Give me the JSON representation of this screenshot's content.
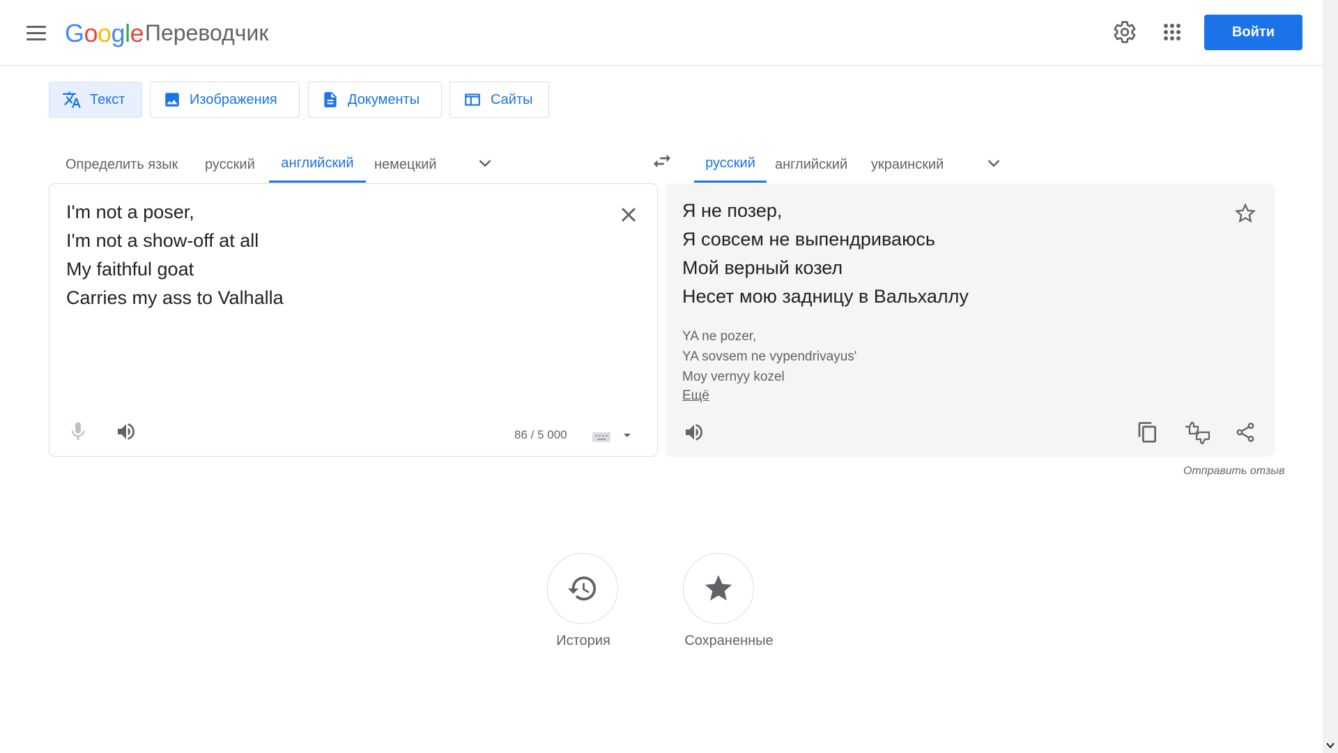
{
  "header": {
    "logo": {
      "G": "G",
      "o1": "o",
      "o2": "o",
      "g": "g",
      "l": "l",
      "e": "e"
    },
    "product": "Переводчик",
    "signin_label": "Войти"
  },
  "modes": [
    {
      "label": "Текст",
      "active": true
    },
    {
      "label": "Изображения",
      "active": false
    },
    {
      "label": "Документы",
      "active": false
    },
    {
      "label": "Сайты",
      "active": false
    }
  ],
  "source_langs": [
    "Определить язык",
    "русский",
    "английский",
    "немецкий"
  ],
  "source_active": "английский",
  "target_langs": [
    "русский",
    "английский",
    "украинский"
  ],
  "target_active": "русский",
  "source": {
    "lines": [
      "I'm not a poser,",
      "I'm not a show-off at all",
      "My faithful goat",
      "Carries my ass to Valhalla"
    ],
    "counter": "86 / 5 000"
  },
  "target": {
    "lines": [
      "Я не позер,",
      "Я совсем не выпендриваюсь",
      "Мой верный козел",
      "Несет мою задницу в Вальхаллу"
    ],
    "translit": [
      "YA ne pozer,",
      "YA sovsem ne vypendrivayus'",
      "Moy vernyy kozel"
    ],
    "more_label": "Ещё"
  },
  "feedback_label": "Отправить отзыв",
  "bottom": {
    "history_label": "История",
    "saved_label": "Сохраненные"
  },
  "colors": {
    "accent": "#1a73e8",
    "active_tab_bg": "#e8f0fe",
    "target_bg": "#f5f5f5",
    "icon": "#5f6368"
  }
}
